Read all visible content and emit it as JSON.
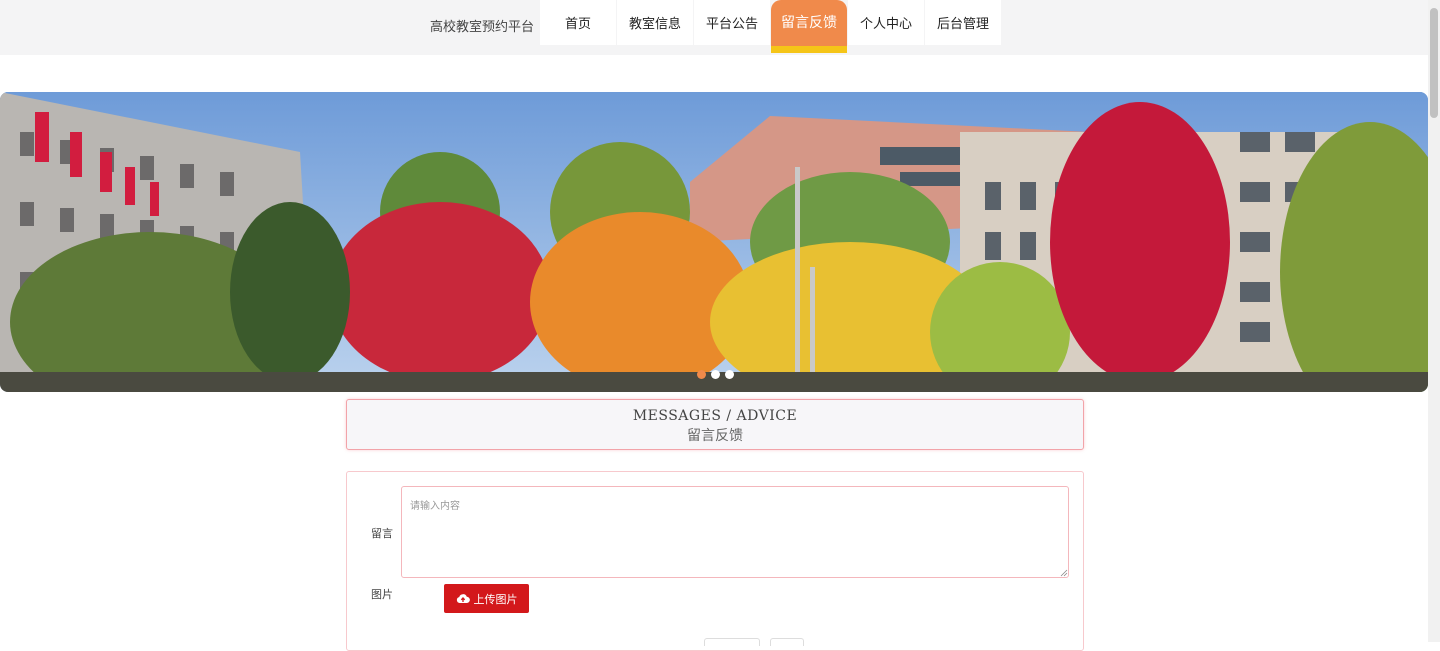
{
  "header": {
    "brand": "高校教室预约平台",
    "nav": [
      {
        "label": "首页",
        "active": false
      },
      {
        "label": "教室信息",
        "active": false
      },
      {
        "label": "平台公告",
        "active": false
      },
      {
        "label": "留言反馈",
        "active": true
      },
      {
        "label": "个人中心",
        "active": false
      },
      {
        "label": "后台管理",
        "active": false
      }
    ],
    "colors": {
      "active_tab": "#f08a4b",
      "active_underline": "#f5c518"
    }
  },
  "banner": {
    "slides_count": 3,
    "active_slide": 1,
    "dot_active_color": "#f08a4b"
  },
  "section_title": {
    "en": "MESSAGES / ADVICE",
    "cn": "留言反馈"
  },
  "form": {
    "message_label": "留言",
    "message_placeholder": "请输入内容",
    "message_value": "",
    "image_label": "图片",
    "upload_button_label": "上传图片",
    "upload_icon": "cloud-upload-icon",
    "upload_button_color": "#d3181b"
  }
}
